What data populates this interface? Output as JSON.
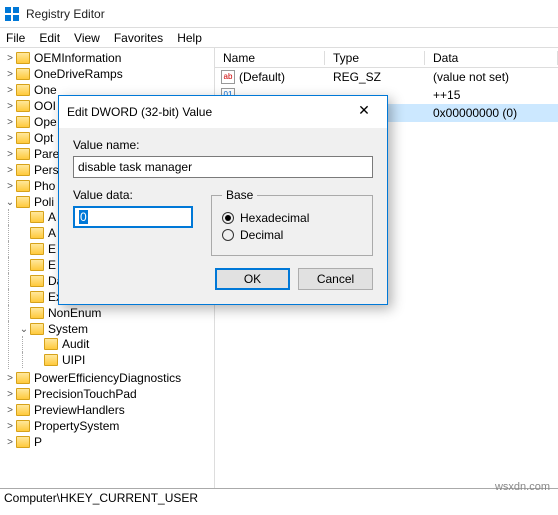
{
  "window": {
    "title": "Registry Editor"
  },
  "menu": {
    "file": "File",
    "edit": "Edit",
    "view": "View",
    "favorites": "Favorites",
    "help": "Help"
  },
  "tree": {
    "items": [
      "OEMInformation",
      "OneDriveRamps",
      "One",
      "OOI",
      "Ope",
      "Opt",
      "Pare",
      "Pers",
      "Pho",
      "Poli"
    ],
    "poli_children": [
      "A",
      "A",
      "E",
      "E",
      "DataCollection",
      "Explorer",
      "NonEnum",
      "System"
    ],
    "system_children": [
      "Audit",
      "UIPI"
    ],
    "tail": [
      "PowerEfficiencyDiagnostics",
      "PrecisionTouchPad",
      "PreviewHandlers",
      "PropertySystem",
      "P"
    ]
  },
  "list": {
    "cols": {
      "name": "Name",
      "type": "Type",
      "data": "Data"
    },
    "rows": [
      {
        "icon": "str",
        "name": "(Default)",
        "type": "REG_SZ",
        "data": "(value not set)",
        "selected": false
      },
      {
        "icon": "bin",
        "name": "",
        "type": "",
        "data": "++15",
        "selected": false
      },
      {
        "icon": "bin",
        "name": "",
        "type": "WORD",
        "data": "0x00000000 (0)",
        "selected": true
      }
    ]
  },
  "dialog": {
    "title": "Edit DWORD (32-bit) Value",
    "value_name_label": "Value name:",
    "value_name": "disable task manager",
    "value_data_label": "Value data:",
    "value_data": "0",
    "base_label": "Base",
    "radio_hex": "Hexadecimal",
    "radio_dec": "Decimal",
    "ok": "OK",
    "cancel": "Cancel"
  },
  "statusbar": "Computer\\HKEY_CURRENT_USER",
  "watermark": "wsxdn.com"
}
